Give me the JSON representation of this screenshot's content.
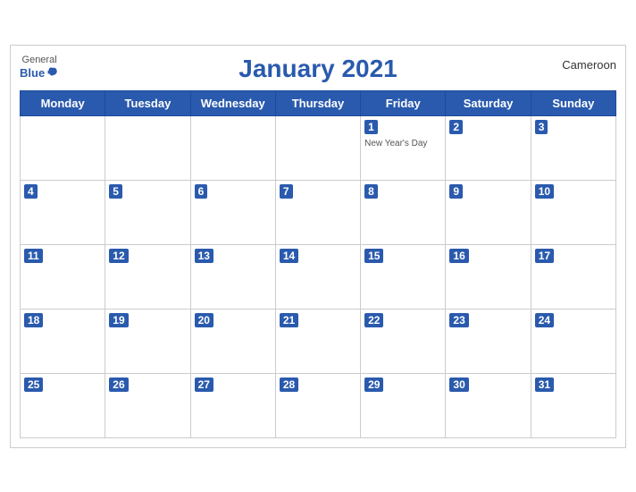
{
  "header": {
    "title": "January 2021",
    "country": "Cameroon",
    "logo_general": "General",
    "logo_blue": "Blue"
  },
  "days_of_week": [
    "Monday",
    "Tuesday",
    "Wednesday",
    "Thursday",
    "Friday",
    "Saturday",
    "Sunday"
  ],
  "weeks": [
    [
      {
        "day": "",
        "empty": true
      },
      {
        "day": "",
        "empty": true
      },
      {
        "day": "",
        "empty": true
      },
      {
        "day": "",
        "empty": true
      },
      {
        "day": "1",
        "holiday": "New Year's Day"
      },
      {
        "day": "2"
      },
      {
        "day": "3"
      }
    ],
    [
      {
        "day": "4"
      },
      {
        "day": "5"
      },
      {
        "day": "6"
      },
      {
        "day": "7"
      },
      {
        "day": "8"
      },
      {
        "day": "9"
      },
      {
        "day": "10"
      }
    ],
    [
      {
        "day": "11"
      },
      {
        "day": "12"
      },
      {
        "day": "13"
      },
      {
        "day": "14"
      },
      {
        "day": "15"
      },
      {
        "day": "16"
      },
      {
        "day": "17"
      }
    ],
    [
      {
        "day": "18"
      },
      {
        "day": "19"
      },
      {
        "day": "20"
      },
      {
        "day": "21"
      },
      {
        "day": "22"
      },
      {
        "day": "23"
      },
      {
        "day": "24"
      }
    ],
    [
      {
        "day": "25"
      },
      {
        "day": "26"
      },
      {
        "day": "27"
      },
      {
        "day": "28"
      },
      {
        "day": "29"
      },
      {
        "day": "30"
      },
      {
        "day": "31"
      }
    ]
  ]
}
